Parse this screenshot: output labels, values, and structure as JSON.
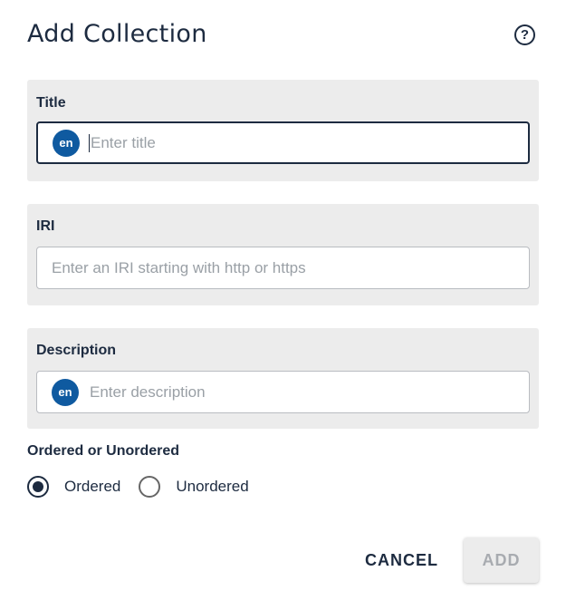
{
  "dialog": {
    "title": "Add Collection",
    "help_icon": "?"
  },
  "title_section": {
    "label": "Title",
    "lang": "en",
    "placeholder": "Enter title",
    "value": ""
  },
  "iri_section": {
    "label": "IRI",
    "placeholder": "Enter an IRI starting with http or https",
    "value": ""
  },
  "description_section": {
    "label": "Description",
    "lang": "en",
    "placeholder": "Enter description",
    "value": ""
  },
  "ordering": {
    "label": "Ordered or Unordered",
    "options": [
      {
        "label": "Ordered",
        "checked": true
      },
      {
        "label": "Unordered",
        "checked": false
      }
    ]
  },
  "actions": {
    "cancel_label": "CANCEL",
    "add_label": "ADD"
  },
  "colors": {
    "primary": "#1d2b40",
    "lang_badge": "#0f5aa0",
    "section_bg": "#ececec",
    "disabled_text": "#a8abb0"
  }
}
